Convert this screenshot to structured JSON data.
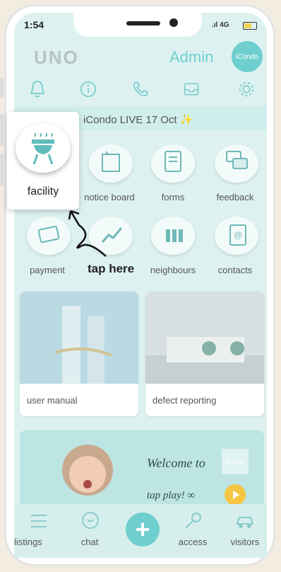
{
  "status": {
    "time": "1:54",
    "network": "4G"
  },
  "header": {
    "logo": "UNO",
    "user": "Admin",
    "avatar_text": "iCondo"
  },
  "top_icons": [
    "bell-icon",
    "info-icon",
    "phone-icon",
    "inbox-icon",
    "gear-icon"
  ],
  "banner": {
    "text": "iCondo LIVE 17 Oct ✨"
  },
  "grid": {
    "row1": [
      "facility",
      "notice board",
      "forms",
      "feedback"
    ],
    "row2": [
      "payment",
      "",
      "neighbours",
      "contacts"
    ]
  },
  "cards": {
    "left": "user manual",
    "right": "defect reporting"
  },
  "welcome": {
    "title": "Welcome to",
    "logo": "iCondo",
    "cta": "tap play! ∞"
  },
  "nav": {
    "listings": "listings",
    "chat": "chat",
    "access": "access",
    "visitors": "visitors"
  },
  "highlight": {
    "label": "facility",
    "callout": "tap here"
  },
  "colors": {
    "accent": "#6fcfcf",
    "screen_bg": "#ddf2f0",
    "play": "#f5c542"
  }
}
